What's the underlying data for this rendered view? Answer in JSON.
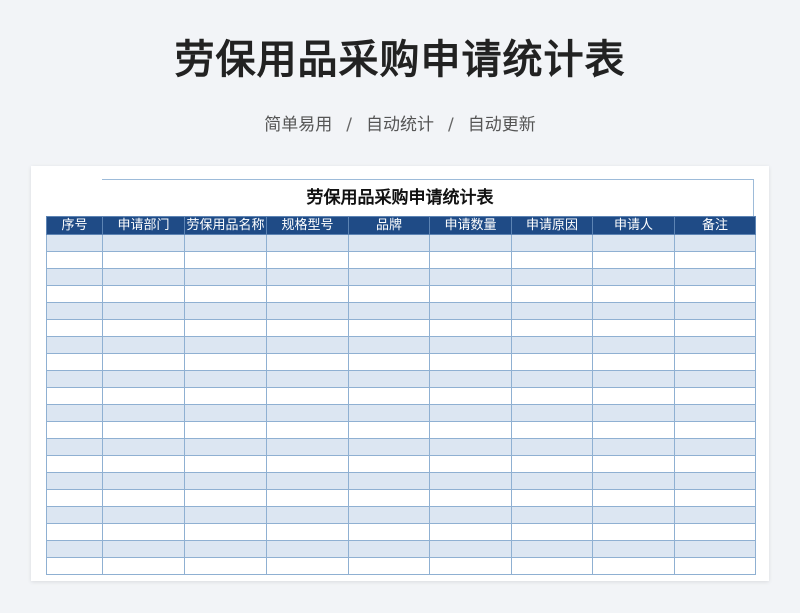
{
  "page": {
    "title": "劳保用品采购申请统计表",
    "subtitle_items": [
      "简单易用",
      "自动统计",
      "自动更新"
    ],
    "separator": "/"
  },
  "sheet": {
    "title": "劳保用品采购申请统计表",
    "columns": [
      "序号",
      "申请部门",
      "劳保用品名称",
      "规格型号",
      "品牌",
      "申请数量",
      "申请原因",
      "申请人",
      "备注"
    ],
    "empty_row_count": 20
  },
  "colors": {
    "header_bg": "#1f4b86",
    "stripe": "#dce6f2",
    "grid_line": "#8fb0d2"
  }
}
